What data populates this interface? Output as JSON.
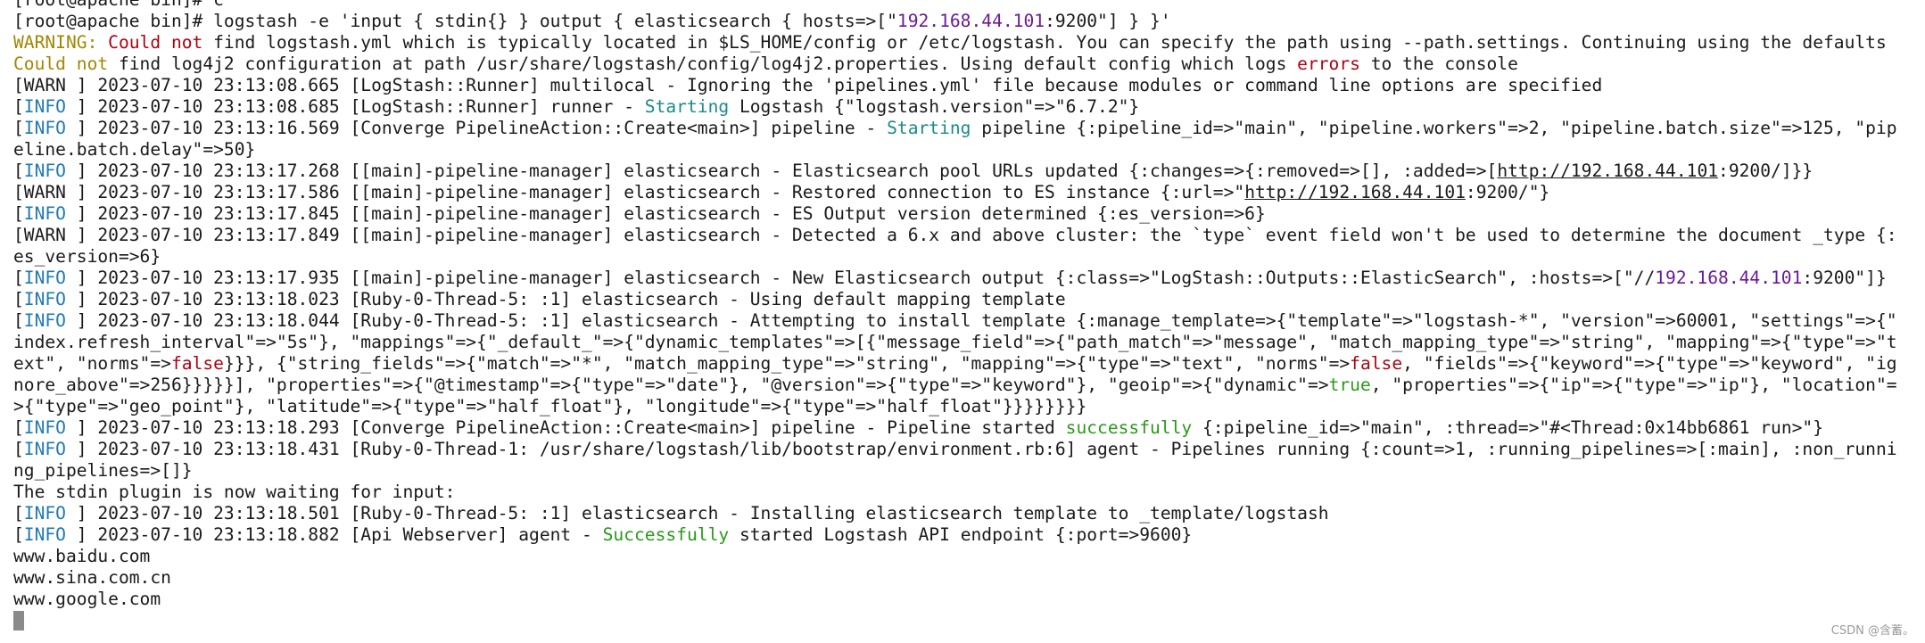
{
  "colors": {
    "background": "#ffffff",
    "text": "#1a1a1a",
    "info": "#1f7ab0",
    "warning": "#a08800",
    "error": "#b00010",
    "teal": "#1a8a8a",
    "purple": "#6a1a9a",
    "green": "#2a9a1a"
  },
  "terminal": {
    "lines": [
      [
        {
          "t": "[root@apache bin]# c",
          "c": "default"
        }
      ],
      [
        {
          "t": "[root@apache bin]# logstash -e 'input { stdin{} } output { elasticsearch { hosts=>[\"",
          "c": "default"
        },
        {
          "t": "192.168.44.101",
          "c": "purple"
        },
        {
          "t": ":9200\"] } }'",
          "c": "default"
        }
      ],
      [
        {
          "t": "WARNING: ",
          "c": "warnword"
        },
        {
          "t": "Could not",
          "c": "red"
        },
        {
          "t": " find logstash.yml which is typically located in $LS_HOME/config or /etc/logstash. You can specify the path using --path.settings. Continuing using the defaults",
          "c": "default"
        }
      ],
      [
        {
          "t": "Could not",
          "c": "warnword"
        },
        {
          "t": " find log4j2 configuration at path /usr/share/logstash/config/log4j2.properties. Using default config which logs ",
          "c": "default"
        },
        {
          "t": "errors",
          "c": "red"
        },
        {
          "t": " to the console",
          "c": "default"
        }
      ],
      [
        {
          "t": "[WARN ] 2023-07-10 23:13:08.665 [LogStash::Runner] multilocal - Ignoring the 'pipelines.yml' file because modules or command line options are specified",
          "c": "default"
        }
      ],
      [
        {
          "t": "[",
          "c": "default"
        },
        {
          "t": "INFO",
          "c": "info"
        },
        {
          "t": " ] 2023-07-10 23:13:08.685 [LogStash::Runner] runner - ",
          "c": "default"
        },
        {
          "t": "Starting",
          "c": "teal"
        },
        {
          "t": " Logstash {\"logstash.version\"=>\"6.7.2\"}",
          "c": "default"
        }
      ],
      [
        {
          "t": "[",
          "c": "default"
        },
        {
          "t": "INFO",
          "c": "info"
        },
        {
          "t": " ] 2023-07-10 23:13:16.569 [Converge PipelineAction::Create<main>] pipeline - ",
          "c": "default"
        },
        {
          "t": "Starting",
          "c": "teal"
        },
        {
          "t": " pipeline {:pipeline_id=>\"main\", \"pipeline.workers\"=>2, \"pipeline.batch.size\"=>125, \"pip",
          "c": "default"
        }
      ],
      [
        {
          "t": "eline.batch.delay\"=>50}",
          "c": "default"
        }
      ],
      [
        {
          "t": "[",
          "c": "default"
        },
        {
          "t": "INFO",
          "c": "info"
        },
        {
          "t": " ] 2023-07-10 23:13:17.268 [[main]-pipeline-manager] elasticsearch - Elasticsearch pool URLs updated {:changes=>{:removed=>[], :added=>[",
          "c": "default"
        },
        {
          "t": "http://192.168.44.101",
          "c": "link"
        },
        {
          "t": ":9200/]}}",
          "c": "default"
        }
      ],
      [
        {
          "t": "[WARN ] 2023-07-10 23:13:17.586 [[main]-pipeline-manager] elasticsearch - Restored connection to ES instance {:url=>\"",
          "c": "default"
        },
        {
          "t": "http://192.168.44.101",
          "c": "link"
        },
        {
          "t": ":9200/\"}",
          "c": "default"
        }
      ],
      [
        {
          "t": "[",
          "c": "default"
        },
        {
          "t": "INFO",
          "c": "info"
        },
        {
          "t": " ] 2023-07-10 23:13:17.845 [[main]-pipeline-manager] elasticsearch - ES Output version determined {:es_version=>6}",
          "c": "default"
        }
      ],
      [
        {
          "t": "[WARN ] 2023-07-10 23:13:17.849 [[main]-pipeline-manager] elasticsearch - Detected a 6.x and above cluster: the `type` event field won't be used to determine the document _type {:",
          "c": "default"
        }
      ],
      [
        {
          "t": "es_version=>6}",
          "c": "default"
        }
      ],
      [
        {
          "t": "[",
          "c": "default"
        },
        {
          "t": "INFO",
          "c": "info"
        },
        {
          "t": " ] 2023-07-10 23:13:17.935 [[main]-pipeline-manager] elasticsearch - New Elasticsearch output {:class=>\"LogStash::Outputs::ElasticSearch\", :hosts=>[\"//",
          "c": "default"
        },
        {
          "t": "192.168.44.101",
          "c": "purple"
        },
        {
          "t": ":9200\"]}",
          "c": "default"
        }
      ],
      [
        {
          "t": "[",
          "c": "default"
        },
        {
          "t": "INFO",
          "c": "info"
        },
        {
          "t": " ] 2023-07-10 23:13:18.023 [Ruby-0-Thread-5: :1] elasticsearch - Using default mapping template",
          "c": "default"
        }
      ],
      [
        {
          "t": "[",
          "c": "default"
        },
        {
          "t": "INFO",
          "c": "info"
        },
        {
          "t": " ] 2023-07-10 23:13:18.044 [Ruby-0-Thread-5: :1] elasticsearch - Attempting to install template {:manage_template=>{\"template\"=>\"logstash-*\", \"version\"=>60001, \"settings\"=>{\"",
          "c": "default"
        }
      ],
      [
        {
          "t": "index.refresh_interval\"=>\"5s\"}, \"mappings\"=>{\"_default_\"=>{\"dynamic_templates\"=>[{\"message_field\"=>{\"path_match\"=>\"message\", \"match_mapping_type\"=>\"string\", \"mapping\"=>{\"type\"=>\"t",
          "c": "default"
        }
      ],
      [
        {
          "t": "ext\", \"norms\"=>",
          "c": "default"
        },
        {
          "t": "false",
          "c": "red"
        },
        {
          "t": "}}}, {\"string_fields\"=>{\"match\"=>\"*\", \"match_mapping_type\"=>\"string\", \"mapping\"=>{\"type\"=>\"text\", \"norms\"=>",
          "c": "default"
        },
        {
          "t": "false",
          "c": "red"
        },
        {
          "t": ", \"fields\"=>{\"keyword\"=>{\"type\"=>\"keyword\", \"ig",
          "c": "default"
        }
      ],
      [
        {
          "t": "nore_above\"=>256}}}}}], \"properties\"=>{\"@timestamp\"=>{\"type\"=>\"date\"}, \"@version\"=>{\"type\"=>\"keyword\"}, \"geoip\"=>{\"dynamic\"=>",
          "c": "default"
        },
        {
          "t": "true",
          "c": "green"
        },
        {
          "t": ", \"properties\"=>{\"ip\"=>{\"type\"=>\"ip\"}, \"location\"=",
          "c": "default"
        }
      ],
      [
        {
          "t": ">{\"type\"=>\"geo_point\"}, \"latitude\"=>{\"type\"=>\"half_float\"}, \"longitude\"=>{\"type\"=>\"half_float\"}}}}}}}}",
          "c": "default"
        }
      ],
      [
        {
          "t": "[",
          "c": "default"
        },
        {
          "t": "INFO",
          "c": "info"
        },
        {
          "t": " ] 2023-07-10 23:13:18.293 [Converge PipelineAction::Create<main>] pipeline - Pipeline started ",
          "c": "default"
        },
        {
          "t": "successfully",
          "c": "green"
        },
        {
          "t": " {:pipeline_id=>\"main\", :thread=>\"#<Thread:0x14bb6861 run>\"}",
          "c": "default"
        }
      ],
      [
        {
          "t": "[",
          "c": "default"
        },
        {
          "t": "INFO",
          "c": "info"
        },
        {
          "t": " ] 2023-07-10 23:13:18.431 [Ruby-0-Thread-1: /usr/share/logstash/lib/bootstrap/environment.rb:6] agent - Pipelines running {:count=>1, :running_pipelines=>[:main], :non_runni",
          "c": "default"
        }
      ],
      [
        {
          "t": "ng_pipelines=>[]}",
          "c": "default"
        }
      ],
      [
        {
          "t": "The stdin plugin is now waiting for input:",
          "c": "default"
        }
      ],
      [
        {
          "t": "[",
          "c": "default"
        },
        {
          "t": "INFO",
          "c": "info"
        },
        {
          "t": " ] 2023-07-10 23:13:18.501 [Ruby-0-Thread-5: :1] elasticsearch - Installing elasticsearch template to _template/logstash",
          "c": "default"
        }
      ],
      [
        {
          "t": "[",
          "c": "default"
        },
        {
          "t": "INFO",
          "c": "info"
        },
        {
          "t": " ] 2023-07-10 23:13:18.882 [Api Webserver] agent - ",
          "c": "default"
        },
        {
          "t": "Successfully",
          "c": "green"
        },
        {
          "t": " started Logstash API endpoint {:port=>9600}",
          "c": "default"
        }
      ],
      [
        {
          "t": "www.baidu.com",
          "c": "default"
        }
      ],
      [
        {
          "t": "www.sina.com.cn",
          "c": "default"
        }
      ],
      [
        {
          "t": "www.google.com",
          "c": "default"
        }
      ]
    ]
  },
  "watermark": "CSDN @含蓄。"
}
